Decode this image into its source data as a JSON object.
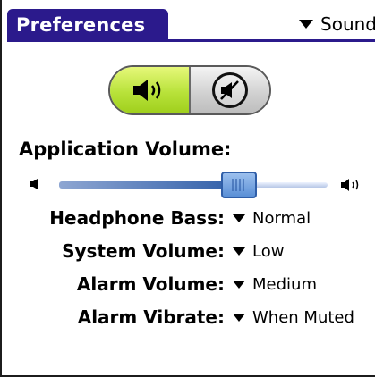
{
  "header": {
    "title": "Preferences",
    "category_selected": "Sound"
  },
  "sound_toggle": {
    "state": "on",
    "on_icon": "speaker-on-icon",
    "off_icon": "speaker-muted-icon",
    "on_color": "#b8e23a"
  },
  "application_volume": {
    "label": "Application Volume:",
    "level": 0.67
  },
  "settings": [
    {
      "label": "Headphone Bass:",
      "value": "Normal"
    },
    {
      "label": "System Volume:",
      "value": "Low"
    },
    {
      "label": "Alarm Volume:",
      "value": "Medium"
    },
    {
      "label": "Alarm Vibrate:",
      "value": "When Muted"
    }
  ],
  "colors": {
    "title_bar": "#2b1a8c",
    "slider_fill": "#2f5ea8"
  }
}
